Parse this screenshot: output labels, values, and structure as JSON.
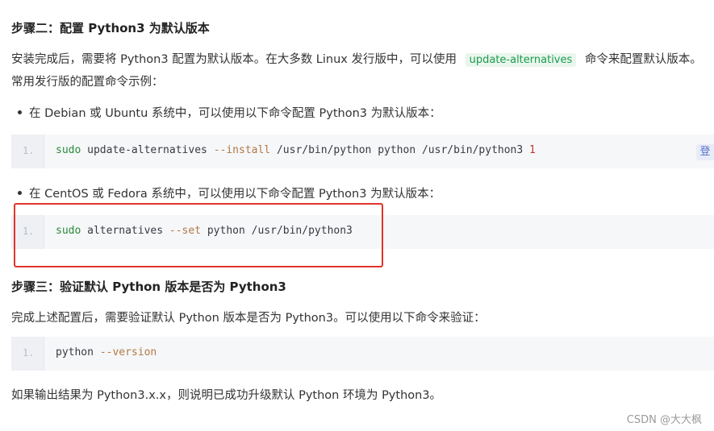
{
  "step2": {
    "heading": "步骤二：配置 Python3 为默认版本",
    "intro_before": "安装完成后，需要将 Python3 配置为默认版本。在大多数 Linux 发行版中，可以使用",
    "intro_code": "update-alternatives",
    "intro_after": "命令来配置默认版本。",
    "intro_line2": "常用发行版的配置命令示例：",
    "bullet_debian": "在 Debian 或 Ubuntu 系统中，可以使用以下命令配置 Python3 为默认版本：",
    "code1": {
      "line_no": "1.",
      "cmd": "sudo",
      "rest1": " update-alternatives ",
      "opt": "--install",
      "rest2": " /usr/bin/python python /usr/bin/python3 ",
      "num": "1"
    },
    "copy_label": "登",
    "bullet_centos": "在 CentOS 或 Fedora 系统中，可以使用以下命令配置 Python3 为默认版本：",
    "code2": {
      "line_no": "1.",
      "cmd": "sudo",
      "rest1": " alternatives ",
      "opt": "--set",
      "rest2": " python /usr/bin/python3"
    }
  },
  "step3": {
    "heading": "步骤三：验证默认 Python 版本是否为 Python3",
    "intro": "完成上述配置后，需要验证默认 Python 版本是否为 Python3。可以使用以下命令来验证：",
    "code": {
      "line_no": "1.",
      "cmd": "python",
      "opt": "--version"
    },
    "result": "如果输出结果为 Python3.x.x，则说明已成功升级默认 Python 环境为 Python3。"
  },
  "watermark": "CSDN @大大枫",
  "colors": {
    "highlight": "#e0342c",
    "keyword": "#2a8a3c",
    "option": "#b07a45"
  }
}
